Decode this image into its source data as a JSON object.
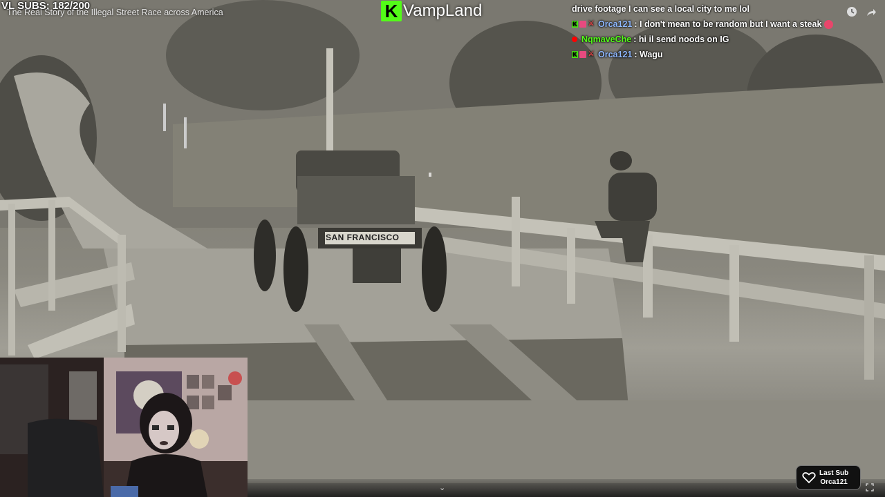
{
  "stream": {
    "subs_label": "VL SUBS: 182/200",
    "video_title": "The Real Story of the Illegal Street Race across America",
    "logo_letter": "K",
    "logo_name": "VampLand",
    "car_sign": "SAN FRANCISCO"
  },
  "chat": {
    "messages": [
      {
        "user": "",
        "text": "drive footage I can see a local city to me lol",
        "user_color": "#ffffff"
      },
      {
        "user": "Orca121",
        "text": ": I don't mean to be random but I want a steak",
        "user_color": "#8fb8ff",
        "badges": [
          "k",
          "gift",
          "sword"
        ]
      },
      {
        "user": "NqmaveChe",
        "text": ": hi il send noods on IG",
        "user_color": "#53fc18",
        "badges": [
          "youtube"
        ]
      },
      {
        "user": "Orca121",
        "text": ": Wagu",
        "user_color": "#8fb8ff",
        "badges": [
          "k",
          "gift",
          "sword"
        ]
      }
    ]
  },
  "overlay": {
    "last_sub_title": "Last Sub",
    "last_sub_name": "Orca121"
  },
  "colors": {
    "kick_green": "#53fc18",
    "accent_blue": "#8fb8ff"
  },
  "icons": [
    "clock-icon",
    "share-icon",
    "heart-icon",
    "chevron-down-icon",
    "fullscreen-icon"
  ]
}
